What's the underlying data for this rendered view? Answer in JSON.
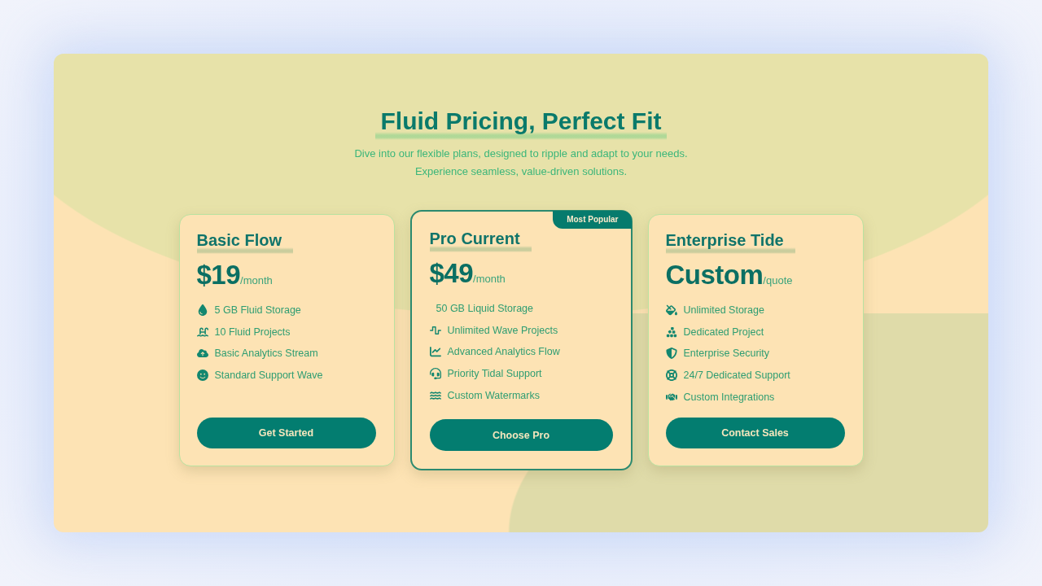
{
  "hero": {
    "title": "Fluid Pricing, Perfect Fit",
    "subtitle": "Dive into our flexible plans, designed to ripple and adapt to your needs. Experience seamless, value-driven solutions."
  },
  "plans": [
    {
      "name": "Basic Flow",
      "featured": false,
      "price": "$19",
      "period": "/month",
      "features": [
        "5 GB Fluid Storage",
        "10 Fluid Projects",
        "Basic Analytics Stream",
        "Standard Support Wave"
      ],
      "button": "Get Started"
    },
    {
      "name": "Pro Current",
      "featured": true,
      "badge": "Most Popular",
      "price": "$49",
      "period": "/month",
      "features": [
        "50 GB Liquid Storage",
        "Unlimited Wave Projects",
        "Advanced Analytics Flow",
        "Priority Tidal Support",
        "Custom Watermarks"
      ],
      "button": "Choose Pro"
    },
    {
      "name": "Enterprise Tide",
      "featured": false,
      "price": "Custom",
      "period": "/quote",
      "features": [
        "Unlimited Storage",
        "Dedicated Project",
        "Enterprise Security",
        "24/7 Dedicated Support",
        "Custom Integrations"
      ],
      "button": "Contact Sales"
    }
  ]
}
